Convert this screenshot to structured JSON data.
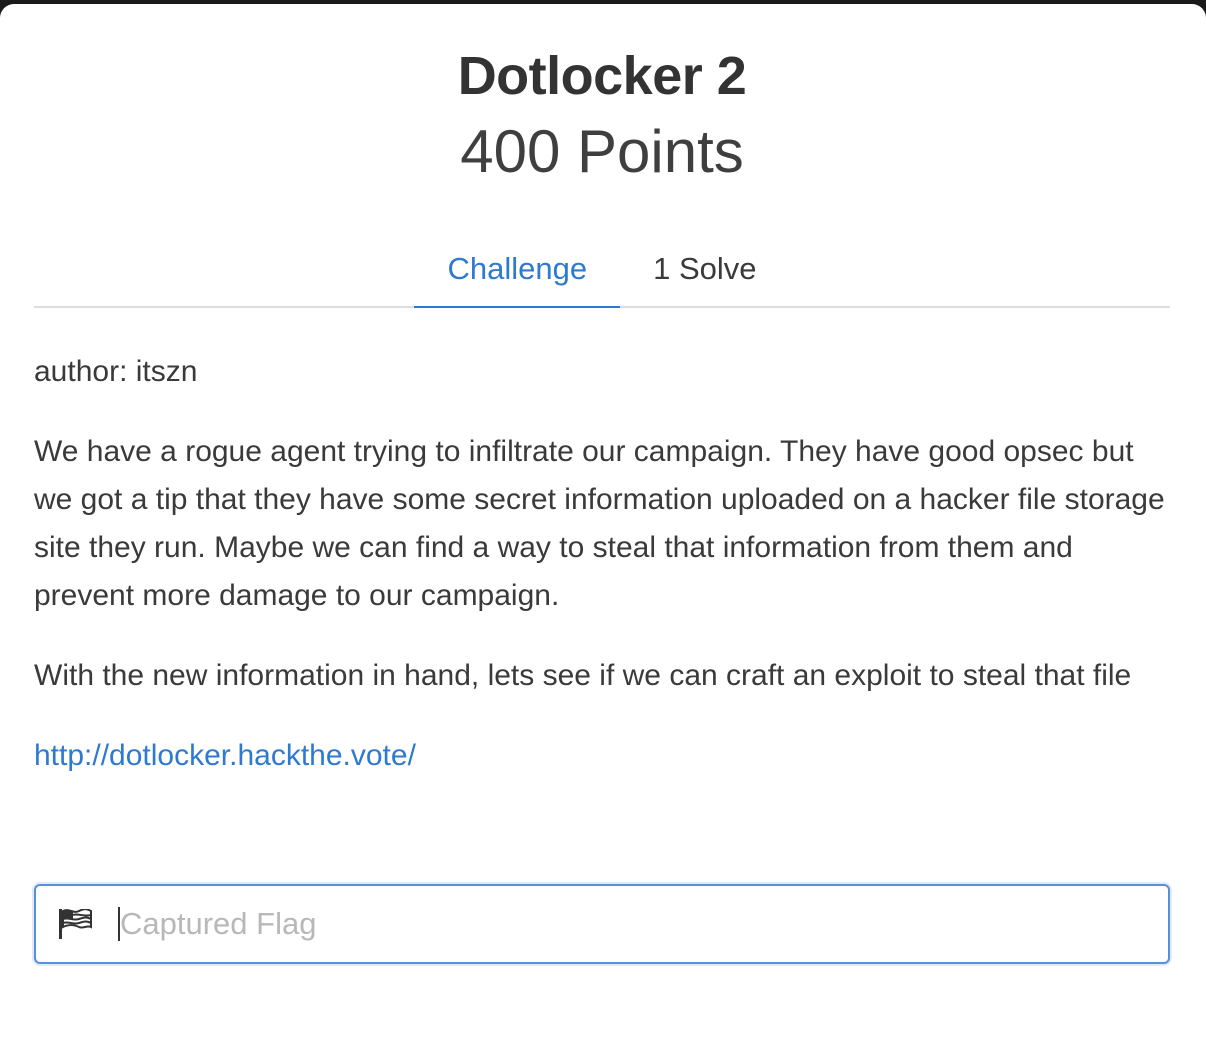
{
  "challenge": {
    "title": "Dotlocker 2",
    "points": "400 Points"
  },
  "tabs": [
    {
      "label": "Challenge",
      "active": true
    },
    {
      "label": "1 Solve",
      "active": false
    }
  ],
  "description": {
    "author": "author: itszn",
    "paragraph1": "We have a rogue agent trying to infiltrate our campaign. They have good opsec but we got a tip that they have some secret information uploaded on a hacker file storage site they run. Maybe we can find a way to steal that information from them and prevent more damage to our campaign.",
    "paragraph2": "With the new information in hand, lets see if we can craft an exploit to steal that file",
    "link": "http://dotlocker.hackthe.vote/"
  },
  "flag_form": {
    "placeholder": "Captured Flag",
    "value": "",
    "icon": "flag-icon"
  },
  "colors": {
    "accent": "#2f7ad1",
    "text": "#3a3a3a",
    "placeholder": "#b8b8b8"
  }
}
